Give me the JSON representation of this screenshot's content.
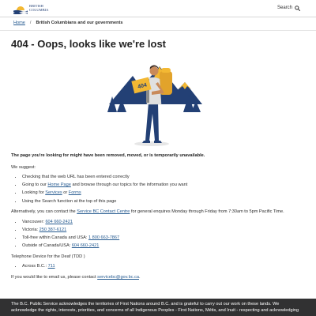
{
  "header": {
    "logo_line1": "BRITISH",
    "logo_line2": "COLUMBIA",
    "search_label": "Search"
  },
  "breadcrumb": {
    "home": "Home",
    "separator": "/",
    "current": "British Columbians and our governments"
  },
  "page_title": "404 - Oops, looks like we're lost",
  "illustration": {
    "sign_text": "404"
  },
  "content": {
    "lead": "The page you're looking for might have been removed, moved, or is temporarily unavailable.",
    "suggest_intro": "We suggest:",
    "suggest_1": "Checking that the web URL has been entered correctly",
    "suggest_2_pre": "Going to our ",
    "suggest_2_link": "Home Page",
    "suggest_2_post": " and browse through our topics for the information you want",
    "suggest_3_pre": "Looking for ",
    "suggest_3_link1": "Services",
    "suggest_3_mid": " or ",
    "suggest_3_link2": "Forms",
    "suggest_4": "Using the Search function at the top of this page",
    "alt_pre": "Alternatively, you can contact the ",
    "alt_link": "Service BC Contact Centre",
    "alt_post": " for general enquires Monday through Friday from 7:30am to 5pm Pacific Time.",
    "phones": [
      {
        "label": "Vancouver: ",
        "number": "604 660-2421"
      },
      {
        "label": "Victoria: ",
        "number": "250 387-6121"
      },
      {
        "label": "Toll-free within Canada and USA: ",
        "number": "1 800 663-7867"
      },
      {
        "label": "Outside of Canada/USA: ",
        "number": "604 660-2421"
      }
    ],
    "tdd_intro": "Telephone Device for the Deaf (TDD )",
    "tdd_label": "Across B.C.: ",
    "tdd_number": "711",
    "email_pre": "If you would like to email us, please contact ",
    "email_link": "servicebc@gov.bc.ca",
    "email_post": "."
  },
  "footer": {
    "text": "The B.C. Public Service acknowledges the territories of First Nations around B.C. and is grateful to carry out our work on these lands. We acknowledge the rights, interests, priorities, and concerns of all Indigenous Peoples - First Nations, Métis, and Inuit - respecting and acknowledging"
  },
  "colors": {
    "brand_blue": "#234075",
    "link": "#255a90",
    "gold": "#f3b833",
    "footer_bg": "#313132"
  }
}
